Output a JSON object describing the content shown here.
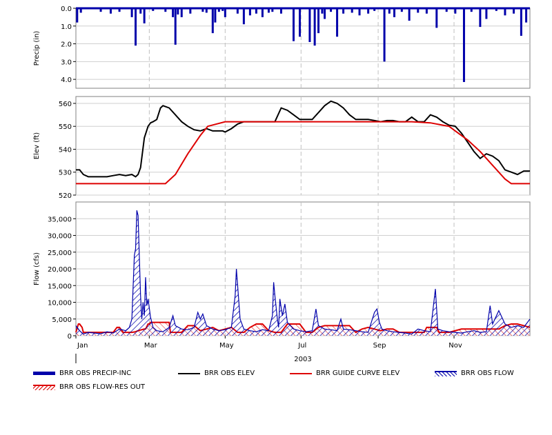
{
  "chart_data": [
    {
      "type": "bar",
      "ylabel": "Precip (in)",
      "ylim": [
        0,
        4.5
      ],
      "yticks": [
        "0.0",
        "1.0",
        "2.0",
        "3.0",
        "4.0"
      ],
      "inverted": true,
      "grid": true,
      "series": [
        {
          "name": "BRR OBS PRECIP-INC",
          "color": "#0000aa",
          "x": [
            1,
            4,
            20,
            28,
            35,
            45,
            48,
            52,
            55,
            62,
            72,
            78,
            80,
            82,
            85,
            92,
            102,
            105,
            110,
            112,
            115,
            118,
            120,
            130,
            135,
            140,
            145,
            150,
            155,
            158,
            165,
            175,
            180,
            188,
            192,
            195,
            198,
            200,
            205,
            210,
            215,
            222,
            228,
            235,
            240,
            248,
            252,
            256,
            262,
            268,
            275,
            282,
            290,
            298,
            305,
            312,
            318,
            325,
            330,
            338,
            345,
            352,
            358,
            362
          ],
          "values": [
            0.8,
            0.25,
            0.2,
            0.3,
            0.2,
            0.5,
            2.1,
            0.3,
            0.85,
            0.15,
            0.2,
            0.5,
            2.05,
            0.35,
            0.5,
            0.3,
            0.2,
            0.25,
            1.4,
            0.8,
            0.2,
            0.15,
            0.5,
            0.3,
            0.9,
            0.4,
            0.3,
            0.5,
            0.25,
            0.2,
            0.3,
            1.85,
            1.6,
            1.9,
            2.1,
            1.4,
            0.3,
            0.6,
            0.2,
            1.6,
            0.3,
            0.25,
            0.4,
            0.3,
            0.15,
            3.0,
            0.3,
            0.5,
            0.2,
            0.7,
            0.25,
            0.3,
            1.1,
            0.2,
            0.3,
            4.15,
            0.2,
            1.05,
            0.6,
            0.15,
            0.4,
            0.3,
            1.55,
            0.8
          ]
        }
      ]
    },
    {
      "type": "line",
      "ylabel": "Elev (ft)",
      "ylim": [
        520,
        563
      ],
      "yticks": [
        "520",
        "530",
        "540",
        "550",
        "560"
      ],
      "grid": true,
      "series": [
        {
          "name": "BRR OBS ELEV",
          "color": "#000000",
          "x": [
            0,
            3,
            6,
            10,
            15,
            20,
            25,
            30,
            35,
            40,
            45,
            48,
            50,
            52,
            55,
            58,
            60,
            62,
            65,
            68,
            70,
            75,
            80,
            85,
            90,
            95,
            100,
            105,
            110,
            115,
            118,
            120,
            125,
            130,
            135,
            140,
            145,
            150,
            155,
            160,
            165,
            170,
            175,
            180,
            185,
            190,
            195,
            200,
            205,
            210,
            215,
            220,
            225,
            230,
            235,
            240,
            245,
            250,
            255,
            260,
            265,
            270,
            275,
            280,
            285,
            290,
            295,
            300,
            305,
            310,
            315,
            320,
            325,
            330,
            335,
            340,
            345,
            350,
            355,
            360,
            365
          ],
          "values": [
            531,
            531,
            529,
            528,
            528,
            528,
            528,
            528.5,
            529,
            528.5,
            529,
            528,
            529,
            532,
            545,
            550,
            551.5,
            552,
            553,
            558,
            559,
            558,
            555,
            552,
            550,
            548.5,
            548,
            549,
            548,
            548,
            548,
            547.5,
            549,
            551,
            552,
            552,
            552,
            552,
            552,
            552,
            558,
            557,
            555,
            553,
            553,
            553,
            556,
            559,
            561,
            560,
            558,
            555,
            553,
            553,
            553,
            552.5,
            552,
            552.5,
            552.5,
            552,
            552,
            554,
            552,
            552,
            555,
            554,
            552,
            550.5,
            550,
            547,
            543,
            539,
            536,
            538,
            537,
            535,
            531,
            530,
            529,
            530.5,
            530.5
          ]
        },
        {
          "name": "BRR GUIDE CURVE ELEV",
          "color": "#dd0000",
          "x": [
            0,
            30,
            60,
            72,
            80,
            90,
            100,
            106,
            120,
            150,
            200,
            250,
            270,
            285,
            295,
            300,
            305,
            315,
            325,
            335,
            345,
            350,
            365
          ],
          "values": [
            525,
            525,
            525,
            525,
            529,
            538,
            546,
            550,
            552,
            552,
            552,
            552,
            552,
            551.5,
            550.5,
            550,
            548,
            544,
            539,
            533,
            527,
            525,
            525
          ]
        }
      ]
    },
    {
      "type": "area",
      "ylabel": "Flow (cfs)",
      "ylim": [
        0,
        40000
      ],
      "yticks": [
        "0",
        "5,000",
        "10,000",
        "15,000",
        "20,000",
        "25,000",
        "30,000",
        "35,000"
      ],
      "xlabel": "2003",
      "xticks": [
        "Jan",
        "Mar",
        "May",
        "Jul",
        "Sep",
        "Nov"
      ],
      "grid": true,
      "series": [
        {
          "name": "BRR OBS FLOW",
          "color": "#0000aa",
          "x": [
            0,
            3,
            6,
            10,
            15,
            20,
            25,
            30,
            35,
            40,
            43,
            45,
            47,
            48,
            49,
            50,
            52,
            53,
            54,
            55,
            56,
            57,
            58,
            60,
            62,
            65,
            70,
            75,
            78,
            80,
            85,
            90,
            95,
            98,
            100,
            102,
            105,
            110,
            115,
            120,
            125,
            128,
            129,
            130,
            132,
            135,
            140,
            145,
            150,
            155,
            158,
            159,
            160,
            162,
            163,
            164,
            166,
            168,
            170,
            175,
            180,
            185,
            190,
            193,
            195,
            200,
            205,
            210,
            213,
            215,
            220,
            225,
            230,
            235,
            240,
            242,
            244,
            246,
            250,
            255,
            260,
            265,
            270,
            275,
            280,
            285,
            289,
            290,
            291,
            295,
            300,
            305,
            310,
            315,
            320,
            325,
            330,
            333,
            335,
            340,
            345,
            350,
            355,
            360,
            365
          ],
          "values": [
            3000,
            1500,
            500,
            1000,
            800,
            600,
            1200,
            800,
            2000,
            1500,
            2500,
            5000,
            24000,
            26000,
            37500,
            36000,
            12000,
            5000,
            10000,
            6000,
            17500,
            9000,
            11000,
            5500,
            2500,
            1500,
            1200,
            2500,
            6000,
            3000,
            2000,
            1800,
            2500,
            7000,
            5000,
            6500,
            3000,
            2000,
            1500,
            1800,
            2500,
            12000,
            20000,
            15000,
            5000,
            2000,
            1500,
            1200,
            1800,
            1500,
            6000,
            16000,
            12000,
            5000,
            2500,
            11000,
            6000,
            9500,
            4000,
            2000,
            1500,
            1200,
            1500,
            8000,
            3000,
            2000,
            1800,
            1500,
            5000,
            2000,
            1800,
            1500,
            1200,
            1000,
            7000,
            8000,
            4000,
            2000,
            1500,
            1200,
            1000,
            800,
            500,
            2000,
            1500,
            1200,
            14000,
            8000,
            2000,
            1500,
            1200,
            1000,
            800,
            1200,
            1500,
            1000,
            1200,
            9000,
            3500,
            7500,
            3500,
            2500,
            3000,
            2500,
            5000
          ]
        },
        {
          "name": "BRR OBS FLOW-RES OUT",
          "color": "#dd0000",
          "x": [
            0,
            2,
            3,
            5,
            6,
            8,
            20,
            30,
            33,
            35,
            38,
            40,
            45,
            48,
            50,
            55,
            56,
            58,
            59,
            60,
            62,
            75,
            76,
            80,
            85,
            90,
            95,
            100,
            105,
            110,
            115,
            120,
            125,
            130,
            135,
            140,
            145,
            150,
            155,
            160,
            165,
            170,
            175,
            180,
            185,
            190,
            195,
            200,
            210,
            220,
            225,
            230,
            235,
            240,
            245,
            250,
            255,
            260,
            270,
            280,
            282,
            290,
            292,
            300,
            310,
            315,
            318,
            320,
            330,
            340,
            345,
            350,
            355,
            360,
            365
          ],
          "values": [
            1000,
            3500,
            3500,
            2500,
            1000,
            1000,
            1000,
            1000,
            2500,
            2500,
            1000,
            1000,
            1000,
            1200,
            1500,
            2000,
            2000,
            3500,
            3500,
            4000,
            4000,
            4000,
            1000,
            1000,
            1000,
            3000,
            3000,
            1500,
            2000,
            2500,
            1500,
            2000,
            2500,
            1000,
            1000,
            2500,
            3500,
            3500,
            1500,
            1000,
            1000,
            3500,
            3500,
            3500,
            1000,
            1000,
            2500,
            3000,
            3000,
            3000,
            1000,
            2000,
            2500,
            2000,
            1500,
            2000,
            2000,
            1000,
            1000,
            1000,
            2500,
            2500,
            1000,
            1000,
            2000,
            2000,
            2000,
            2000,
            2000,
            2000,
            3000,
            3500,
            3500,
            3000,
            2500
          ]
        }
      ]
    }
  ],
  "legend": {
    "items": [
      {
        "label": "BRR OBS PRECIP-INC",
        "color": "#0000aa",
        "style": "thick-line"
      },
      {
        "label": "BRR OBS ELEV",
        "color": "#000000",
        "style": "line"
      },
      {
        "label": "BRR GUIDE CURVE ELEV",
        "color": "#dd0000",
        "style": "line"
      },
      {
        "label": "BRR OBS FLOW",
        "color": "#0000aa",
        "style": "hatch"
      },
      {
        "label": "BRR OBS FLOW-RES OUT",
        "color": "#dd0000",
        "style": "hatch"
      }
    ]
  }
}
